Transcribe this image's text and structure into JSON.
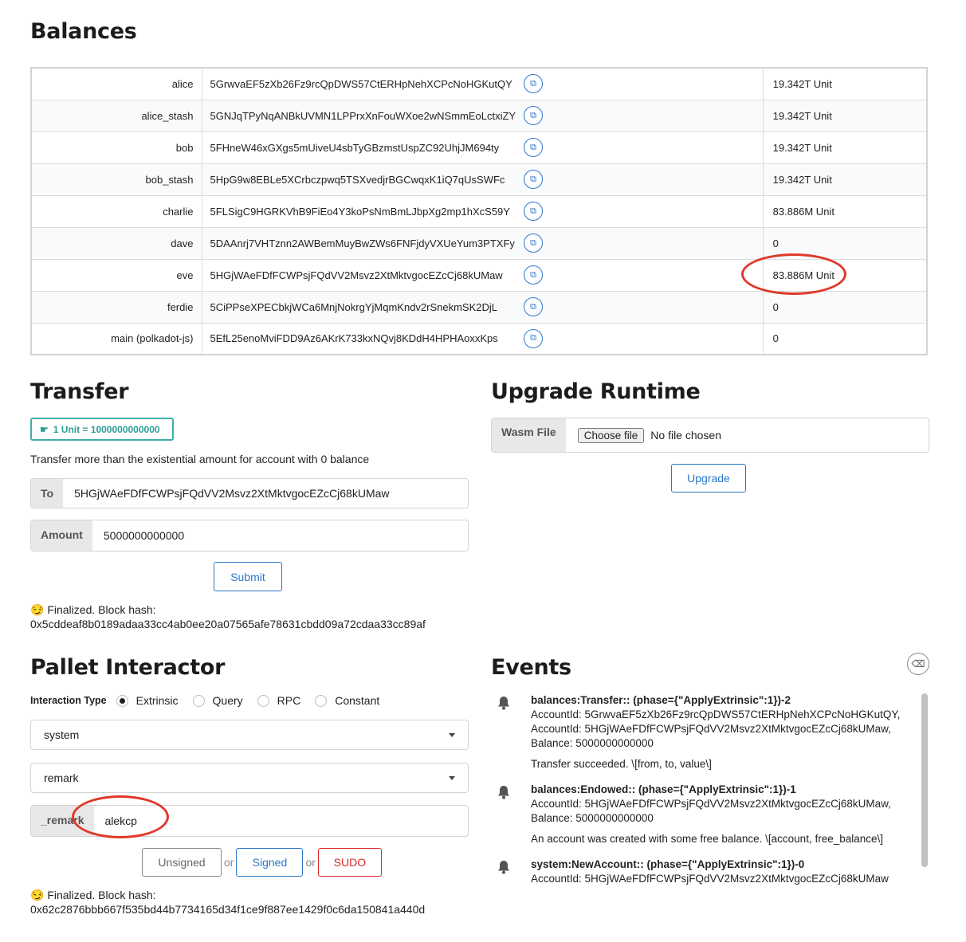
{
  "balances": {
    "title": "Balances",
    "rows": [
      {
        "name": "alice",
        "address": "5GrwvaEF5zXb26Fz9rcQpDWS57CtERHpNehXCPcNoHGKutQY",
        "balance": "19.342T Unit"
      },
      {
        "name": "alice_stash",
        "address": "5GNJqTPyNqANBkUVMN1LPPrxXnFouWXoe2wNSmmEoLctxiZY",
        "balance": "19.342T Unit"
      },
      {
        "name": "bob",
        "address": "5FHneW46xGXgs5mUiveU4sbTyGBzmstUspZC92UhjJM694ty",
        "balance": "19.342T Unit"
      },
      {
        "name": "bob_stash",
        "address": "5HpG9w8EBLe5XCrbczpwq5TSXvedjrBGCwqxK1iQ7qUsSWFc",
        "balance": "19.342T Unit"
      },
      {
        "name": "charlie",
        "address": "5FLSigC9HGRKVhB9FiEo4Y3koPsNmBmLJbpXg2mp1hXcS59Y",
        "balance": "83.886M Unit"
      },
      {
        "name": "dave",
        "address": "5DAAnrj7VHTznn2AWBemMuyBwZWs6FNFjdyVXUeYum3PTXFy",
        "balance": "0"
      },
      {
        "name": "eve",
        "address": "5HGjWAeFDfFCWPsjFQdVV2Msvz2XtMktvgocEZcCj68kUMaw",
        "balance": "83.886M Unit"
      },
      {
        "name": "ferdie",
        "address": "5CiPPseXPECbkjWCa6MnjNokrgYjMqmKndv2rSnekmSK2DjL",
        "balance": "0"
      },
      {
        "name": "main (polkadot-js)",
        "address": "5EfL25enoMviFDD9Az6AKrK733kxNQvj8KDdH4HPHAoxxKps",
        "balance": "0"
      }
    ]
  },
  "transfer": {
    "title": "Transfer",
    "unit_label": "1 Unit = 1000000000000",
    "help": "Transfer more than the existential amount for account with 0 balance",
    "to_label": "To",
    "to_value": "5HGjWAeFDfFCWPsjFQdVV2Msvz2XtMktvgocEZcCj68kUMaw",
    "amount_label": "Amount",
    "amount_value": "5000000000000",
    "submit_label": "Submit",
    "status_line1": "😏 Finalized. Block hash:",
    "status_line2": "0x5cddeaf8b0189adaa33cc4ab0ee20a07565afe78631cbdd09a72cdaa33cc89af"
  },
  "upgrade": {
    "title": "Upgrade Runtime",
    "wasm_label": "Wasm File",
    "choose_label": "Choose file",
    "no_file": "No file chosen",
    "upgrade_label": "Upgrade"
  },
  "pallet": {
    "title": "Pallet Interactor",
    "interaction_label": "Interaction Type",
    "types": [
      "Extrinsic",
      "Query",
      "RPC",
      "Constant"
    ],
    "selected_type": "Extrinsic",
    "pallet_value": "system",
    "callable_value": "remark",
    "param_label": "_remark",
    "param_value": "alekcp",
    "unsigned_label": "Unsigned",
    "or_label": "or",
    "signed_label": "Signed",
    "sudo_label": "SUDO",
    "status_line1": "😏 Finalized. Block hash:",
    "status_line2": "0x62c2876bbb667f535bd44b7734165d34f1ce9f887ee1429f0c6da150841a440d"
  },
  "events": {
    "title": "Events",
    "items": [
      {
        "head": "balances:Transfer:: (phase={\"ApplyExtrinsic\":1})-2",
        "lines": [
          "AccountId: 5GrwvaEF5zXb26Fz9rcQpDWS57CtERHpNehXCPcNoHGKutQY,",
          "AccountId: 5HGjWAeFDfFCWPsjFQdVV2Msvz2XtMktvgocEZcCj68kUMaw,",
          "Balance: 5000000000000"
        ],
        "doc": "Transfer succeeded. \\[from, to, value\\]"
      },
      {
        "head": "balances:Endowed:: (phase={\"ApplyExtrinsic\":1})-1",
        "lines": [
          "AccountId: 5HGjWAeFDfFCWPsjFQdVV2Msvz2XtMktvgocEZcCj68kUMaw,",
          "Balance: 5000000000000"
        ],
        "doc": "An account was created with some free balance. \\[account, free_balance\\]"
      },
      {
        "head": "system:NewAccount:: (phase={\"ApplyExtrinsic\":1})-0",
        "lines": [
          "AccountId: 5HGjWAeFDfFCWPsjFQdVV2Msvz2XtMktvgocEZcCj68kUMaw"
        ],
        "doc": ""
      }
    ]
  },
  "colors": {
    "accent": "#2a78c8",
    "teal": "#3fafa6",
    "sudo": "#db2828",
    "annotation": "#e0392b"
  }
}
